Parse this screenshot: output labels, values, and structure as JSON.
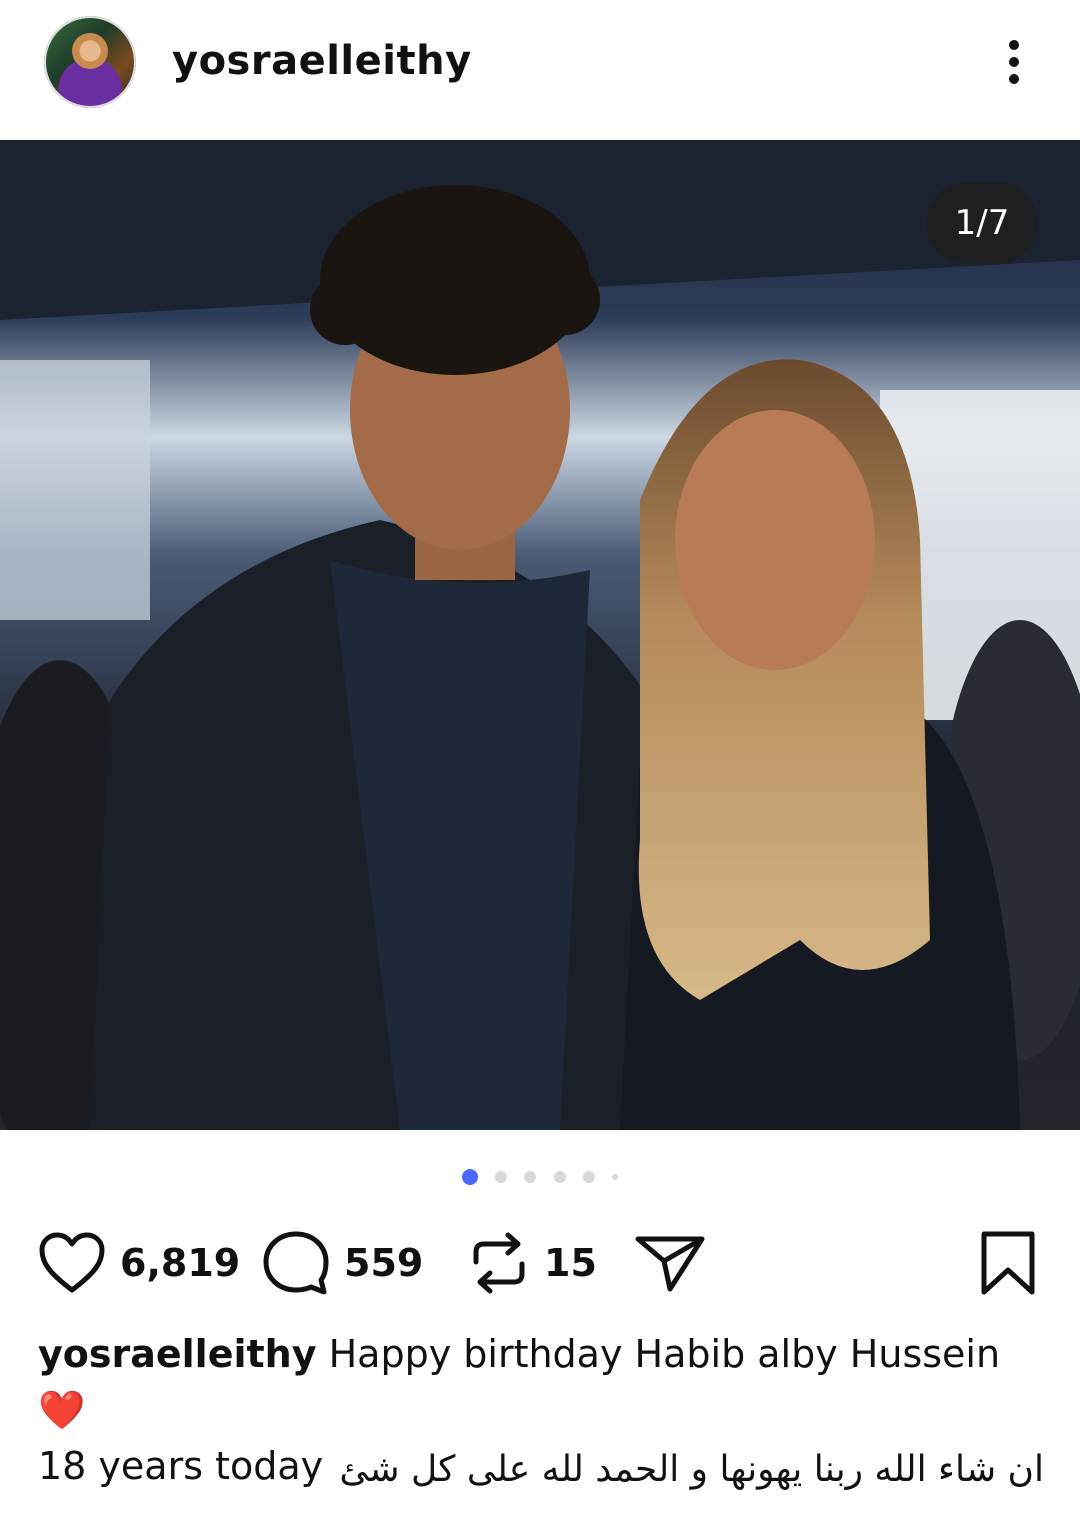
{
  "header": {
    "username": "yosraelleithy",
    "avatar_icon": "profile-avatar",
    "more_icon": "more-vertical-icon"
  },
  "post": {
    "counter": "1/7",
    "carousel": {
      "total_dots": 6,
      "active_index": 0
    }
  },
  "actions": {
    "likes": "6,819",
    "comments": "559",
    "reposts": "15"
  },
  "caption": {
    "username": "yosraelleithy",
    "text_line1": "Happy birthday Habib alby Hussein",
    "emoji": "❤️",
    "text_line2": "18 years today",
    "arabic_line": "ان شاء الله ربنا يهونها و الحمد لله على كل شئ"
  },
  "colors": {
    "active_dot": "#4a68ff",
    "heart_emoji": "#e53935"
  }
}
